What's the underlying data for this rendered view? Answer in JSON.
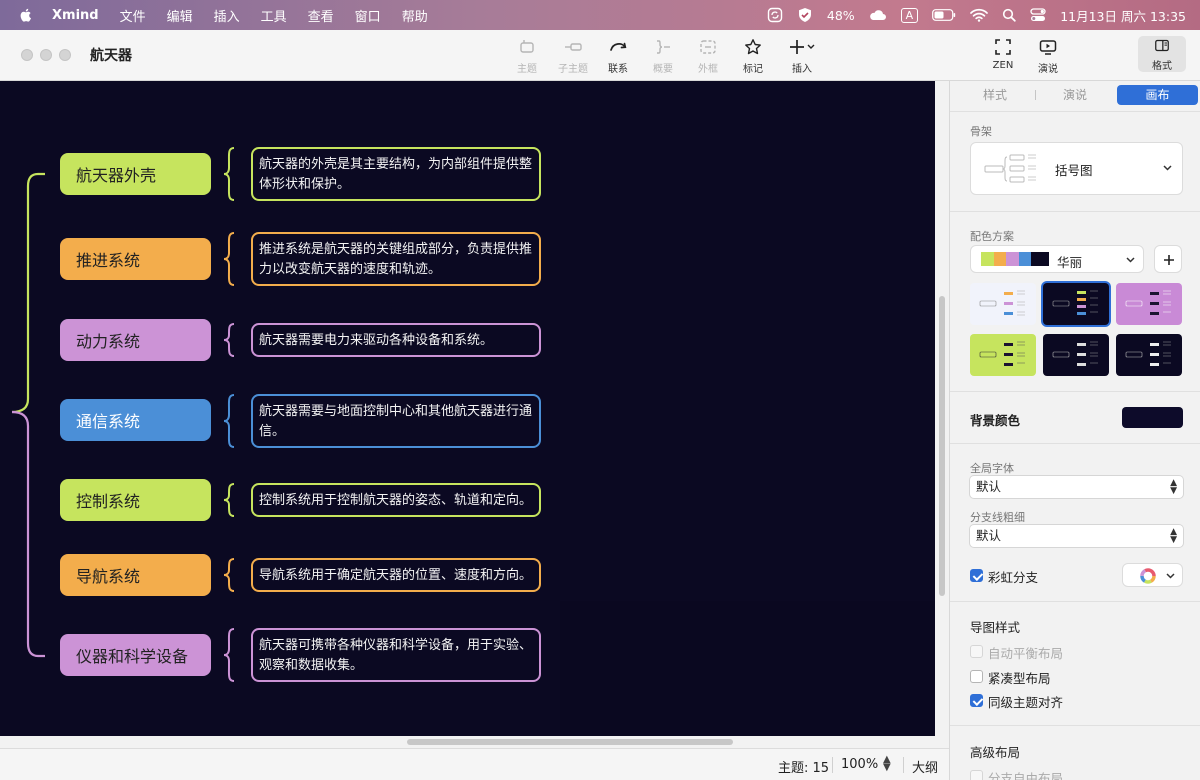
{
  "menubar": {
    "app_name": "Xmind",
    "items": [
      "文件",
      "编辑",
      "插入",
      "工具",
      "查看",
      "窗口",
      "帮助"
    ],
    "battery_percent": "48%",
    "input_method": "A",
    "datetime": "11月13日 周六  13:35"
  },
  "window": {
    "title": "航天器"
  },
  "toolbar": {
    "buttons": [
      {
        "label": "主题",
        "icon": "topic-icon",
        "enabled": false
      },
      {
        "label": "子主题",
        "icon": "subtopic-icon",
        "enabled": false
      },
      {
        "label": "联系",
        "icon": "relationship-icon",
        "enabled": true
      },
      {
        "label": "概要",
        "icon": "summary-icon",
        "enabled": false
      },
      {
        "label": "外框",
        "icon": "boundary-icon",
        "enabled": false
      },
      {
        "label": "标记",
        "icon": "star-icon",
        "enabled": true
      },
      {
        "label": "插入",
        "icon": "plus-icon",
        "enabled": true
      },
      {
        "label": "ZEN",
        "icon": "zen-icon",
        "enabled": true
      },
      {
        "label": "演说",
        "icon": "present-icon",
        "enabled": true
      },
      {
        "label": "格式",
        "icon": "format-panel-icon",
        "enabled": true
      }
    ]
  },
  "mindmap": {
    "background": "#0b0922",
    "branches": [
      {
        "topic": "航天器外壳",
        "summary": "航天器的外壳是其主要结构，为内部组件提供整体形状和保护。",
        "color": "#c6e45e"
      },
      {
        "topic": "推进系统",
        "summary": "推进系统是航天器的关键组成部分，负责提供推力以改变航天器的速度和轨迹。",
        "color": "#f3ad4c"
      },
      {
        "topic": "动力系统",
        "summary": "航天器需要电力来驱动各种设备和系统。",
        "color": "#cc93d6"
      },
      {
        "topic": "通信系统",
        "summary": "航天器需要与地面控制中心和其他航天器进行通信。",
        "color": "#4b8fd7"
      },
      {
        "topic": "控制系统",
        "summary": "控制系统用于控制航天器的姿态、轨道和定向。",
        "color": "#c6e45e"
      },
      {
        "topic": "导航系统",
        "summary": "导航系统用于确定航天器的位置、速度和方向。",
        "color": "#f3ad4c"
      },
      {
        "topic": "仪器和科学设备",
        "summary": "航天器可携带各种仪器和科学设备，用于实验、观察和数据收集。",
        "color": "#cc93d6"
      }
    ]
  },
  "statusbar": {
    "topic_count": "主题: 15",
    "zoom": "100%",
    "outline": "大纲"
  },
  "panel": {
    "tabs": [
      "样式",
      "演说",
      "画布"
    ],
    "active_tab": "画布",
    "skeleton_label": "骨架",
    "skeleton_value": "括号图",
    "color_scheme_label": "配色方案",
    "color_scheme_value": "华丽",
    "color_scheme_swatches": [
      "#c6e45e",
      "#f3ad4c",
      "#cc93d6",
      "#4b8fd7",
      "#0b0922"
    ],
    "background_color_label": "背景颜色",
    "background_color": "#0d0b2a",
    "global_font_label": "全局字体",
    "global_font_value": "默认",
    "branch_width_label": "分支线粗细",
    "branch_width_value": "默认",
    "rainbow_branch_label": "彩虹分支",
    "rainbow_branch_checked": true,
    "map_style_label": "导图样式",
    "map_style_options": [
      {
        "label": "自动平衡布局",
        "checked": false,
        "enabled": false
      },
      {
        "label": "紧凑型布局",
        "checked": false,
        "enabled": true
      },
      {
        "label": "同级主题对齐",
        "checked": true,
        "enabled": true
      }
    ],
    "advanced_layout_label": "高级布局",
    "advanced_layout_option": "分支自由布局"
  }
}
